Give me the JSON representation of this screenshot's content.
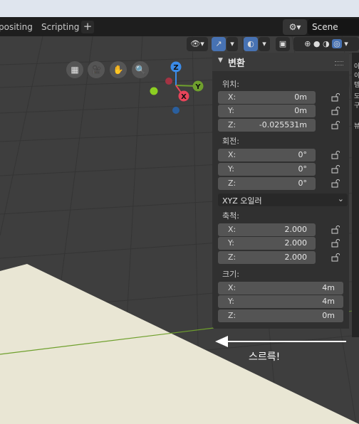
{
  "tabs": {
    "compositing": "positing",
    "scripting": "Scripting",
    "add": "+"
  },
  "scene": {
    "icon": "scene-icon",
    "name": "Scene"
  },
  "transform": {
    "title": "변환",
    "location": {
      "label": "위치:",
      "x": {
        "axis": "X:",
        "value": "0m"
      },
      "y": {
        "axis": "Y:",
        "value": "0m"
      },
      "z": {
        "axis": "Z:",
        "value": "-0.025531m"
      }
    },
    "rotation": {
      "label": "회전:",
      "x": {
        "axis": "X:",
        "value": "0°"
      },
      "y": {
        "axis": "Y:",
        "value": "0°"
      },
      "z": {
        "axis": "Z:",
        "value": "0°"
      }
    },
    "rotation_mode": "XYZ 오일러",
    "scale": {
      "label": "축척:",
      "x": {
        "axis": "X:",
        "value": "2.000"
      },
      "y": {
        "axis": "Y:",
        "value": "2.000"
      },
      "z": {
        "axis": "Z:",
        "value": "2.000"
      }
    },
    "dimensions": {
      "label": "크기:",
      "x": {
        "axis": "X:",
        "value": "4m"
      },
      "y": {
        "axis": "Y:",
        "value": "4m"
      },
      "z": {
        "axis": "Z:",
        "value": "0m"
      }
    }
  },
  "gizmo": {
    "x": "X",
    "y": "Y",
    "z": "Z"
  },
  "sidebar_tabs": [
    "아이템",
    "도구",
    "뷰"
  ],
  "annotation": "스르륵!",
  "colors": {
    "accent": "#4772b3",
    "x_axis": "#e8445a",
    "y_axis": "#6fa02d",
    "z_axis": "#3b8be8",
    "floor": "#e9e6d4"
  }
}
